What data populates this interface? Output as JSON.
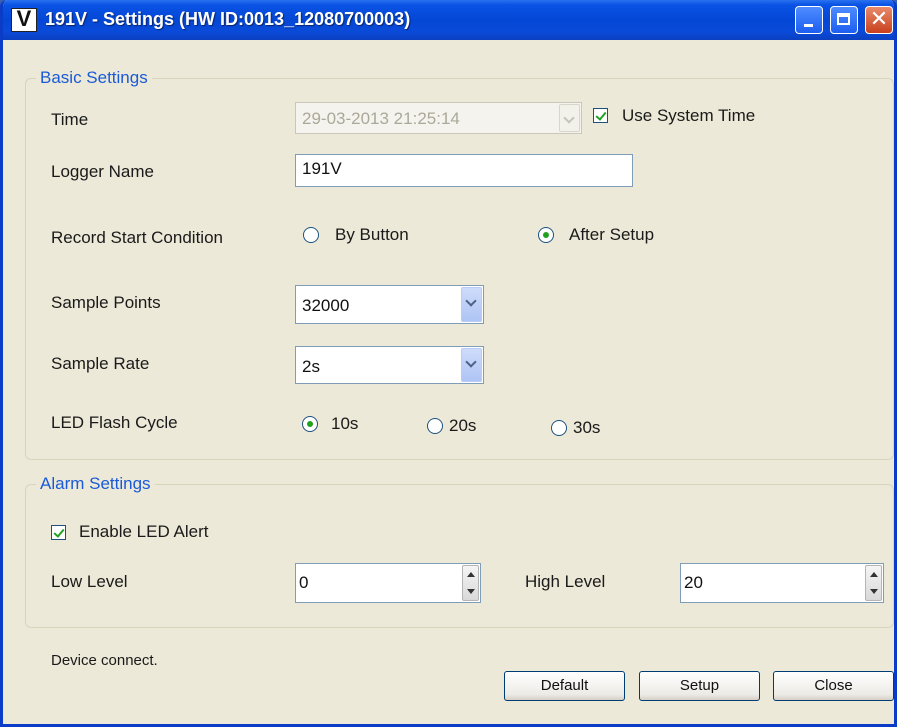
{
  "window": {
    "app_icon_letter": "V",
    "title": "191V - Settings (HW ID:0013_12080700003)"
  },
  "basic": {
    "legend": "Basic Settings",
    "time_label": "Time",
    "time_value": "29-03-2013 21:25:14",
    "use_system_time_label": "Use System Time",
    "use_system_time_checked": true,
    "logger_name_label": "Logger Name",
    "logger_name_value": "191V",
    "record_start_label": "Record Start Condition",
    "record_start_options": [
      "By Button",
      "After Setup"
    ],
    "record_start_selected": "After Setup",
    "sample_points_label": "Sample Points",
    "sample_points_value": "32000",
    "sample_rate_label": "Sample Rate",
    "sample_rate_value": "2s",
    "led_flash_label": "LED Flash Cycle",
    "led_flash_options": [
      "10s",
      "20s",
      "30s"
    ],
    "led_flash_selected": "10s"
  },
  "alarm": {
    "legend": "Alarm Settings",
    "enable_led_alert_label": "Enable LED Alert",
    "enable_led_alert_checked": true,
    "low_level_label": "Low Level",
    "low_level_value": "0",
    "high_level_label": "High Level",
    "high_level_value": "20"
  },
  "status": "Device connect.",
  "buttons": {
    "default": "Default",
    "setup": "Setup",
    "close": "Close"
  }
}
